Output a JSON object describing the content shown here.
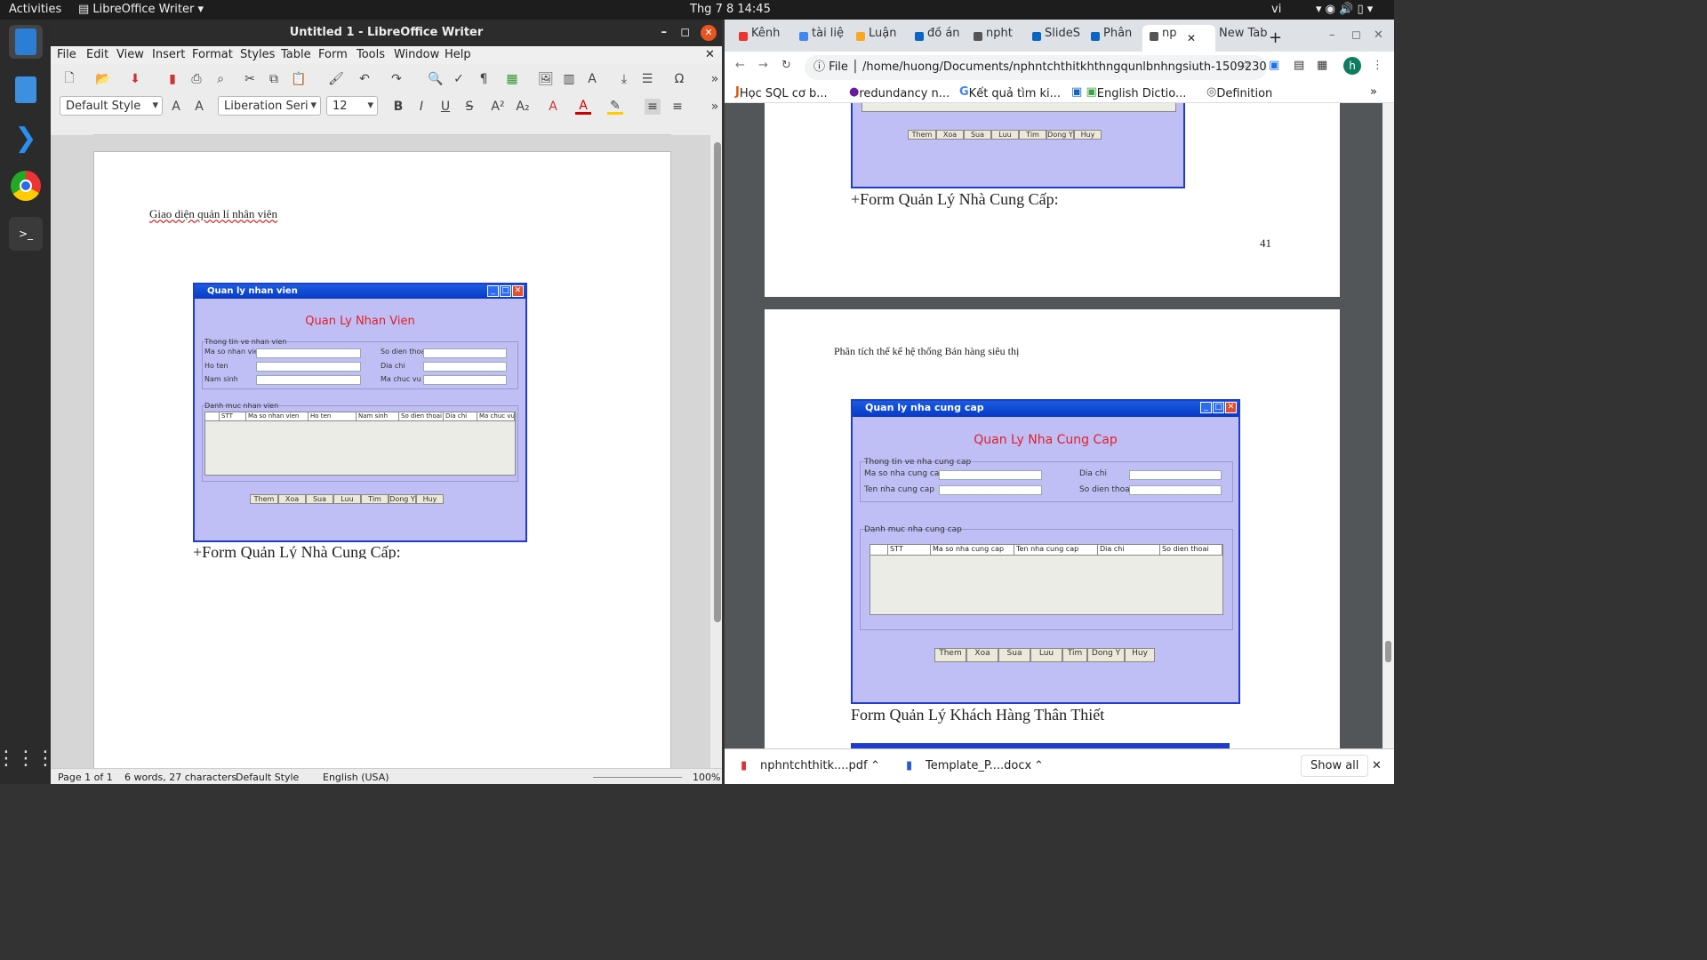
{
  "topbar": {
    "activities": "Activities",
    "app": "LibreOffice Writer",
    "clock": "Thg 7 8  14:45",
    "lang": "vi"
  },
  "dock": {
    "items": [
      "libreoffice-writer-icon",
      "text-editor-icon",
      "vscode-icon",
      "chrome-icon",
      "terminal-icon",
      "apps-grid-icon"
    ]
  },
  "writer": {
    "title": "Untitled 1 - LibreOffice Writer",
    "menu": [
      "File",
      "Edit",
      "View",
      "Insert",
      "Format",
      "Styles",
      "Table",
      "Form",
      "Tools",
      "Window",
      "Help"
    ],
    "para_style": "Default Style",
    "font_name": "Liberation Seri",
    "font_size": "12",
    "doc_heading": "Giao diện quản lí nhân viên",
    "doc_caption": "+Form Quản Lý Nhà Cung Cấp:",
    "form": {
      "window_title": "Quan ly nhan vien",
      "heading": "Quan Ly Nhan Vien",
      "info_group": "Thong tin ve nhan vien",
      "fields_left": [
        "Ma so nhan vien",
        "Ho ten",
        "Nam sinh"
      ],
      "fields_right": [
        "So dien thoai",
        "Dia chi",
        "Ma chuc vu"
      ],
      "list_group": "Danh muc nhan vien",
      "columns": [
        "STT",
        "Ma so nhan vien",
        "Ho ten",
        "Nam sinh",
        "So dien thoai",
        "Dia chi",
        "Ma chuc vu"
      ],
      "buttons": [
        "Them",
        "Xoa",
        "Sua",
        "Luu",
        "Tim",
        "Dong Y",
        "Huy"
      ]
    },
    "status": {
      "page": "Page 1 of 1",
      "words": "6 words, 27 characters",
      "style": "Default Style",
      "lang": "English (USA)",
      "zoom": "100%"
    }
  },
  "chrome": {
    "tabs": [
      "Kênh",
      "tài liệ",
      "Luận",
      "đồ án",
      "npht",
      "SlideS",
      "Phân",
      "np",
      "New Tab"
    ],
    "url": "/home/huong/Documents/nphntchthitkhthngqunlbnhngsiuth-150923020807-...",
    "url_scheme": "File",
    "bookmarks": [
      "Học SQL cơ b...",
      "redundancy n...",
      "Kết quả tìm ki...",
      "English Dictio...",
      "Definition"
    ],
    "pdf": {
      "page_number": "41",
      "caption_top": "+Form Quản Lý Nhà Cung Cấp:",
      "page_header": "Phân tích thế kế hệ thống Bán hàng siêu thị",
      "caption_bottom": "Form Quản Lý Khách Hàng Thân Thiết",
      "top_buttons": [
        "Them",
        "Xoa",
        "Sua",
        "Luu",
        "Tim",
        "Dong Y",
        "Huy"
      ],
      "form": {
        "window_title": "Quan ly nha cung cap",
        "heading": "Quan Ly Nha Cung Cap",
        "info_group": "Thong tin ve nha cung cap",
        "fields_left": [
          "Ma so nha cung cap",
          "Ten nha cung cap"
        ],
        "fields_right": [
          "Dia chi",
          "So dien thoai"
        ],
        "list_group": "Danh muc nha cung cap",
        "columns": [
          "STT",
          "Ma so nha cung cap",
          "Ten nha cung cap",
          "Dia chi",
          "So dien thoai"
        ],
        "buttons": [
          "Them",
          "Xoa",
          "Sua",
          "Luu",
          "Tim",
          "Dong Y",
          "Huy"
        ]
      }
    },
    "downloads": [
      "nphntchthitk....pdf",
      "Template_P....docx"
    ],
    "show_all": "Show all"
  }
}
